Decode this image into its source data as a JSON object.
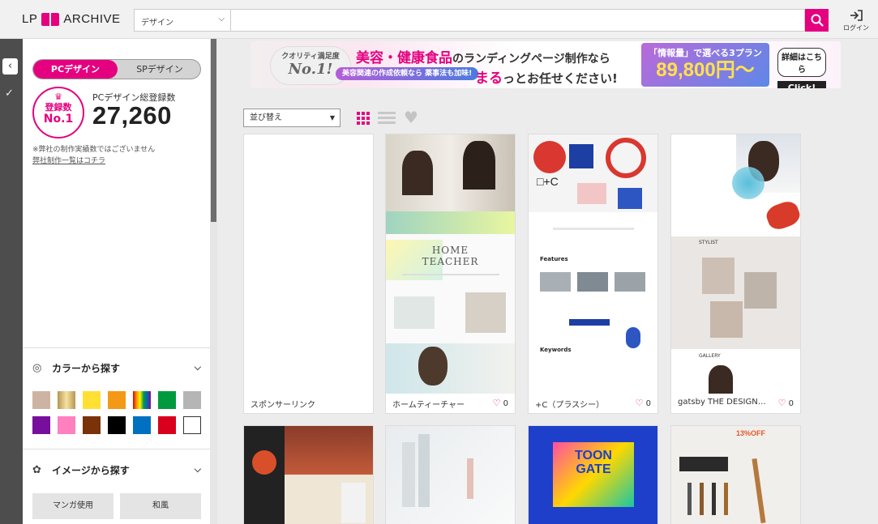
{
  "header": {
    "logo_left": "LP",
    "logo_right": "ARCHIVE",
    "category_select": "デザイン",
    "search_placeholder": "",
    "login_label": "ログイン"
  },
  "sidebar": {
    "toggle_pc": "PCデザイン",
    "toggle_sp": "SPデザイン",
    "badge_line1": "登録数",
    "badge_line2": "No.1",
    "total_label": "PCデザイン総登録数",
    "total_count": "27,260",
    "note": "※弊社の制作実績数ではございません",
    "note_link": "弊社制作一覧はコチラ",
    "color_section": "カラーから探す",
    "image_section": "イメージから探す",
    "image_buttons": [
      "マンガ使用",
      "和風"
    ],
    "colors": [
      "#cdb4a2",
      "#d9c07a",
      "#ffe033",
      "#f39817",
      "rainbow",
      "#009a3e",
      "#b5b5b5",
      "#770f9c",
      "#ff80bf",
      "#7a3209",
      "#000000",
      "#0070c0",
      "#d9001b",
      "#ffffff"
    ]
  },
  "banner": {
    "quality": "クオリティ満足度",
    "no1": "No.1!",
    "main": "美容・健康食品",
    "main_tail": "のランディングページ制作なら",
    "sub": "美容関連の作成依頼なら 薬事法も加味!",
    "line2": "まる",
    "line2_tail": "っとお任せください!",
    "plan_title": "「情報量」で選べる3プラン",
    "plan_price": "89,800円〜",
    "detail": "詳細はこちら",
    "click": "Click!"
  },
  "toolbar": {
    "sort_label": "並び替え"
  },
  "cards": [
    {
      "title": "スポンサーリンク",
      "likes": ""
    },
    {
      "title": "ホームティーチャー",
      "likes": "0"
    },
    {
      "title": "+C（プラスシー）",
      "likes": "0"
    },
    {
      "title": "gatsby THE DESIGN…",
      "likes": "0"
    }
  ],
  "thumb_text": {
    "home_teacher": "HOME\nTEACHER",
    "features": "Features",
    "keywords": "Keywords",
    "stylist": "STYLIST",
    "gallery": "GALLERY",
    "toon": "TOON\nGATE",
    "sale": "13%OFF"
  }
}
